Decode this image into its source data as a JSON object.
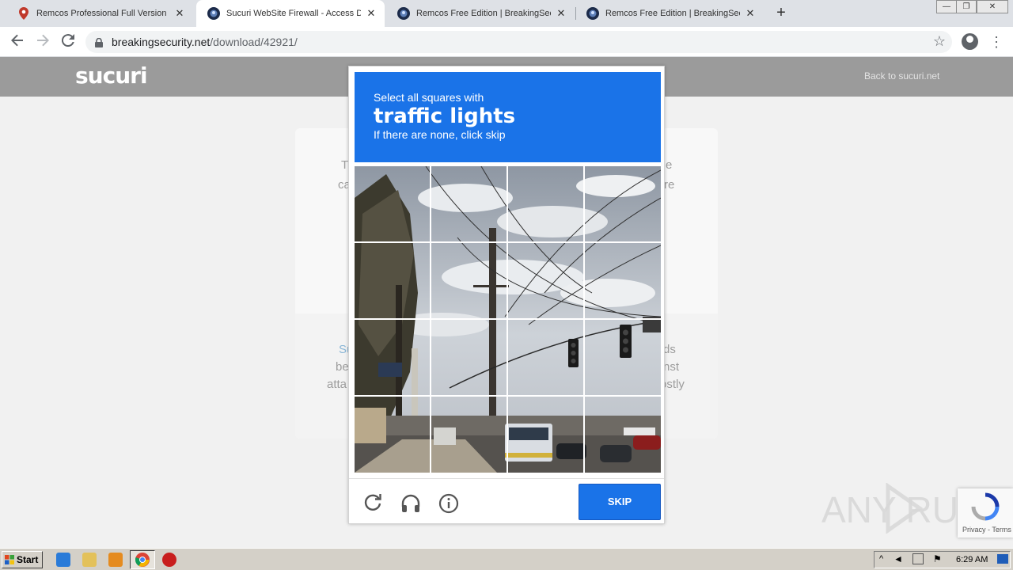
{
  "browser": {
    "tabs": [
      {
        "title": "Remcos Professional Full Version Download",
        "active": false
      },
      {
        "title": "Sucuri WebSite Firewall - Access Denied",
        "active": true
      },
      {
        "title": "Remcos Free Edition | BreakingSecurity",
        "active": false
      },
      {
        "title": "Remcos Free Edition | BreakingSecurity",
        "active": false
      }
    ],
    "url_host": "breakingsecurity.net",
    "url_path": "/download/42921/"
  },
  "page": {
    "logo": "sucuri",
    "back_link": "Back to sucuri.net",
    "card_fragments_left": [
      "T",
      "ca"
    ],
    "card_fragments_right": [
      "e",
      "re"
    ],
    "lower_left": [
      "Su",
      "be",
      "atta"
    ],
    "lower_right": [
      "ds",
      "nst",
      "ostly"
    ]
  },
  "captcha": {
    "line1": "Select all squares with",
    "target": "traffic lights",
    "line3": "If there are none, click skip",
    "skip_label": "SKIP",
    "accent": "#1a73e8"
  },
  "overlay": {
    "watermark": "ANY RUN",
    "badge_terms": "Privacy - Terms"
  },
  "taskbar": {
    "start_label": "Start",
    "clock": "6:29 AM"
  }
}
